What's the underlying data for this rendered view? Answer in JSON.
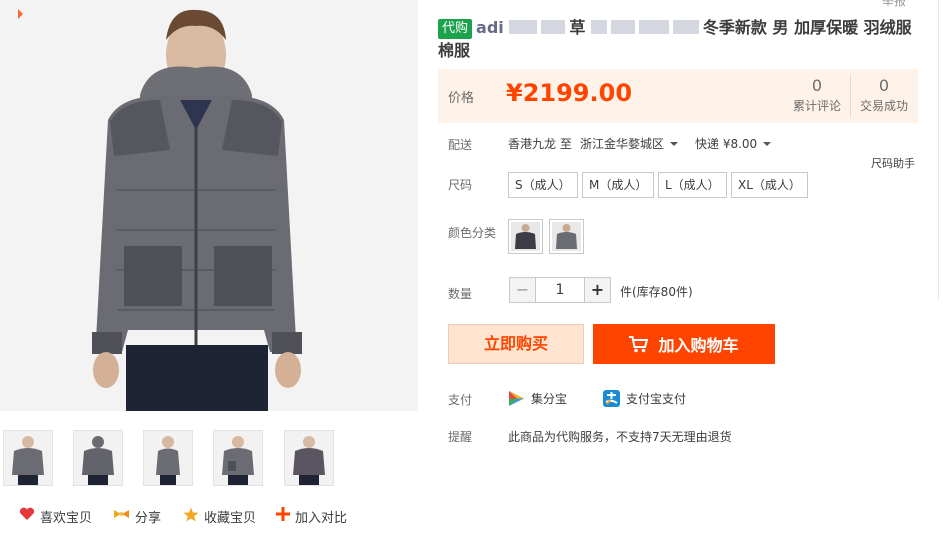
{
  "top_cut_text": "举报",
  "title": {
    "tag": "代购",
    "text_start": "adi",
    "text_mid": "草",
    "text_end": "冬季新款 男 加厚保暖 羽绒服 棉服"
  },
  "price": {
    "label": "价格",
    "value": "¥2199.00",
    "reviews_count": "0",
    "reviews_label": "累计评论",
    "deals_count": "0",
    "deals_label": "交易成功"
  },
  "shipping": {
    "label": "配送",
    "from": "香港九龙 至",
    "to": "浙江金华婺城区",
    "method": "快递 ¥8.00"
  },
  "size": {
    "label": "尺码",
    "helper": "尺码助手",
    "options": [
      "S（成人）",
      "M（成人）",
      "L（成人）",
      "XL（成人）"
    ]
  },
  "color": {
    "label": "颜色分类"
  },
  "quantity": {
    "label": "数量",
    "minus": "−",
    "value": "1",
    "plus": "+",
    "stock": "件(库存80件)"
  },
  "buttons": {
    "buy_now": "立即购买",
    "add_cart": "加入购物车"
  },
  "payment": {
    "label": "支付",
    "method1": "集分宝",
    "method2": "支付宝支付"
  },
  "reminder": {
    "label": "提醒",
    "text": "此商品为代购服务，不支持7天无理由退货"
  },
  "actions": {
    "like": "喜欢宝贝",
    "share": "分享",
    "favorite": "收藏宝贝",
    "compare": "加入对比"
  },
  "colors": {
    "price_red": "#ff4400",
    "accent_green": "#1aa24d",
    "price_bg": "#fff2e8"
  }
}
